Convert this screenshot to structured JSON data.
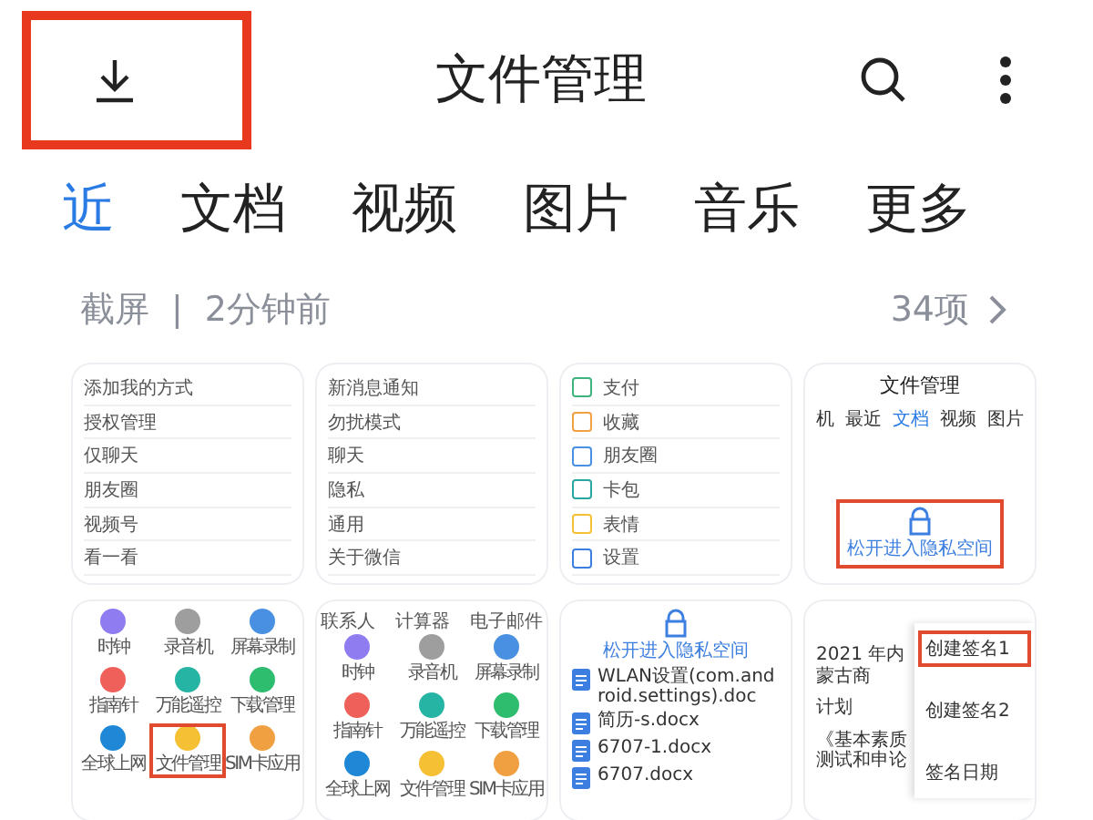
{
  "top_bar": {
    "title": "文件管理",
    "download_highlighted": true
  },
  "tabs": [
    {
      "label": "近",
      "selected": true
    },
    {
      "label": "文档",
      "selected": false
    },
    {
      "label": "视频",
      "selected": false
    },
    {
      "label": "图片",
      "selected": false
    },
    {
      "label": "音乐",
      "selected": false
    },
    {
      "label": "更多",
      "selected": false
    }
  ],
  "section": {
    "name": "截屏",
    "separator": "|",
    "time": "2分钟前",
    "count": "34项"
  },
  "thumbnails": [
    {
      "kind": "settings_list",
      "rows": [
        {
          "label": "添加我的方式"
        },
        {
          "label": "授权管理"
        },
        {
          "label": "仅聊天"
        },
        {
          "label": "朋友圈"
        },
        {
          "label": "视频号"
        },
        {
          "label": "看一看"
        }
      ]
    },
    {
      "kind": "settings_list",
      "rows": [
        {
          "label": "新消息通知"
        },
        {
          "label": "勿扰模式"
        },
        {
          "label": "聊天"
        },
        {
          "label": "隐私"
        },
        {
          "label": "通用"
        },
        {
          "label": "关于微信"
        }
      ]
    },
    {
      "kind": "icon_list",
      "rows": [
        {
          "label": "支付",
          "color": "#3fb27f"
        },
        {
          "label": "收藏",
          "color": "#f0a040"
        },
        {
          "label": "朋友圈",
          "color": "#4a90e2"
        },
        {
          "label": "卡包",
          "color": "#2aa6a0"
        },
        {
          "label": "表情",
          "color": "#f5c033"
        },
        {
          "label": "设置",
          "color": "#3d7fe0"
        }
      ]
    },
    {
      "kind": "app_screen",
      "title": "文件管理",
      "tabs": [
        {
          "label": "机",
          "selected": false
        },
        {
          "label": "最近",
          "selected": false
        },
        {
          "label": "文档",
          "selected": true
        },
        {
          "label": "视频",
          "selected": false
        },
        {
          "label": "图片",
          "selected": false
        }
      ],
      "private_label": "松开进入隐私空间",
      "highlighted": true
    },
    {
      "kind": "app_grid",
      "apps": [
        {
          "label": "时钟",
          "color": "#8e7cf0",
          "highlighted": false
        },
        {
          "label": "录音机",
          "color": "#9e9e9e",
          "highlighted": false
        },
        {
          "label": "屏幕录制",
          "color": "#4a90e2",
          "highlighted": false
        },
        {
          "label": "指南针",
          "color": "#f0605a",
          "highlighted": false
        },
        {
          "label": "万能遥控",
          "color": "#26b5a5",
          "highlighted": false
        },
        {
          "label": "下载管理",
          "color": "#2ebd6e",
          "highlighted": false
        },
        {
          "label": "全球上网",
          "color": "#1e88d6",
          "highlighted": false
        },
        {
          "label": "文件管理",
          "color": "#f5c033",
          "highlighted": true
        },
        {
          "label": "SIM卡应用",
          "color": "#f0a040",
          "highlighted": false
        }
      ]
    },
    {
      "kind": "app_grid",
      "header_labels": [
        "联系人",
        "计算器",
        "电子邮件"
      ],
      "apps": [
        {
          "label": "时钟",
          "color": "#8e7cf0",
          "highlighted": false
        },
        {
          "label": "录音机",
          "color": "#9e9e9e",
          "highlighted": false
        },
        {
          "label": "屏幕录制",
          "color": "#4a90e2",
          "highlighted": false
        },
        {
          "label": "指南针",
          "color": "#f0605a",
          "highlighted": false
        },
        {
          "label": "万能遥控",
          "color": "#26b5a5",
          "highlighted": false
        },
        {
          "label": "下载管理",
          "color": "#2ebd6e",
          "highlighted": false
        },
        {
          "label": "全球上网",
          "color": "#1e88d6",
          "highlighted": false
        },
        {
          "label": "文件管理",
          "color": "#f5c033",
          "highlighted": false
        },
        {
          "label": "SIM卡应用",
          "color": "#f0a040",
          "highlighted": false
        }
      ]
    },
    {
      "kind": "file_list",
      "private_label": "松开进入隐私空间",
      "files": [
        {
          "name": "WLAN设置(com.android.settings).doc"
        },
        {
          "name": "简历-s.docx"
        },
        {
          "name": "6707-1.docx"
        },
        {
          "name": "6707.docx"
        }
      ]
    },
    {
      "kind": "document",
      "lines": [
        "2021 年内蒙古商",
        "计划",
        "《基本素质测试和申论"
      ],
      "menu": [
        {
          "label": "创建签名1",
          "highlighted": true
        },
        {
          "label": "创建签名2",
          "highlighted": false
        },
        {
          "label": "签名日期",
          "highlighted": false
        }
      ]
    }
  ]
}
